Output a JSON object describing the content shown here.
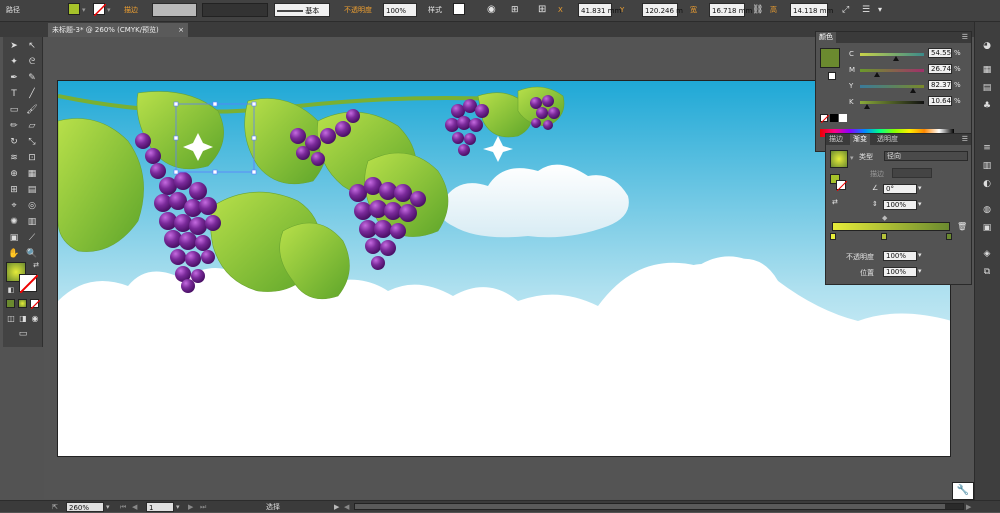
{
  "control_bar": {
    "object_type": "路径",
    "stroke_label": "描边",
    "stroke_value": "",
    "profile_label": "基本",
    "opacity_label": "不透明度",
    "opacity_value": "100%",
    "style_label": "样式",
    "x_label": "X",
    "x_value": "41.831 mm",
    "y_label": "Y",
    "y_value": "120.246 m",
    "w_label": "宽",
    "w_value": "16.718 mm",
    "h_label": "高",
    "h_value": "14.118 mm"
  },
  "document": {
    "tab_title": "未标题-3* @ 260% (CMYK/预览)",
    "close": "×"
  },
  "status_bar": {
    "zoom": "260%",
    "page": "1",
    "mode": "选择"
  },
  "color_panel": {
    "title": "颜色",
    "channels": [
      {
        "label": "C",
        "value": "54.55",
        "unit": "%"
      },
      {
        "label": "M",
        "value": "26.74",
        "unit": "%"
      },
      {
        "label": "Y",
        "value": "82.37",
        "unit": "%"
      },
      {
        "label": "K",
        "value": "10.64",
        "unit": "%"
      }
    ],
    "swatch_color": "#6b8a2f"
  },
  "gradient_panel": {
    "tabs": [
      "描边",
      "渐变",
      "透明度"
    ],
    "type_label": "类型",
    "type_value": "径向",
    "stroke_label": "描边",
    "angle_value": "0°",
    "aspect_value": "100%",
    "opacity_label": "不透明度",
    "opacity_value": "100%",
    "location_label": "位置",
    "location_value": "100%",
    "gradient_start": "#e6ec3a",
    "gradient_end": "#6b8a2f"
  },
  "colors": {
    "sky_top": "#29b0d8",
    "grape": "#7a2a9a",
    "leaf": "#8cc63f",
    "accent_orange": "#f0a030"
  }
}
